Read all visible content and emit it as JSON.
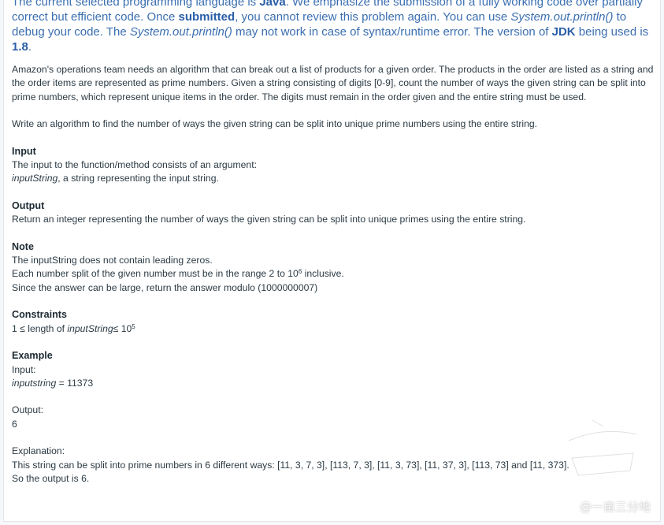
{
  "notice": {
    "t1": "The current selected programming language is ",
    "lang": "Java",
    "t2": ". We emphasize the submission of a fully working code over partially correct but efficient code. Once ",
    "submitted": "submitted",
    "t3": ", you cannot review this problem again. You can use ",
    "println1": "System.out.println()",
    "t4": " to debug your code. The ",
    "println2": "System.out.println()",
    "t5": " may not work in case of syntax/runtime error. The version of ",
    "jdk": "JDK",
    "t6": " being used is ",
    "version": "1.8",
    "t7": "."
  },
  "problem": {
    "description": "Amazon's operations team needs an algorithm that can break out a list of products for a given order. The products in the order are listed as a string and the order items are represented as prime numbers. Given a string consisting of digits [0-9], count the number of ways the given string can be split into prime numbers, which represent unique items in the order. The digits must remain in the order given and the entire string must be used.",
    "task": "Write an algorithm to find the number of ways the given string can be split into unique prime numbers using the entire string.",
    "input_heading": "Input",
    "input_line1": "The input to the function/method consists of an argument:",
    "input_var": "inputString",
    "input_line2": ", a string representing the input string.",
    "output_heading": "Output",
    "output_line": "Return an integer representing the number of ways the given string can be split into unique primes using the entire string.",
    "note_heading": "Note",
    "note_line1": "The inputString does not contain leading zeros.",
    "note_line2_pre": "Each number split of the given number must be in the range 2 to 10",
    "note_line2_exp": "6",
    "note_line2_post": " inclusive.",
    "note_line3": "Since the answer can be large, return the answer modulo (1000000007)",
    "constraints_heading": "Constraints",
    "constraint_pre": "1 ≤ length of ",
    "constraint_var": "inputString",
    "constraint_mid": "≤ 10",
    "constraint_exp": "5",
    "example_heading": "Example",
    "ex_input_label": "Input:",
    "ex_input_var": "inputstring",
    "ex_input_val": " = 11373",
    "ex_output_label": "Output:",
    "ex_output_val": "6",
    "ex_expl_label": "Explanation:",
    "ex_expl_line": "This string can be split into prime numbers in 6 different ways: [11, 3, 7, 3], [113, 7, 3], [11, 3, 73], [11, 37, 3], [113, 73] and [11, 373].",
    "ex_conclusion": "So the output is 6."
  },
  "watermark": {
    "text": "@一亩三分地"
  },
  "colors": {
    "notice_text": "#3b6fb0",
    "body_text": "#2b3a44"
  }
}
